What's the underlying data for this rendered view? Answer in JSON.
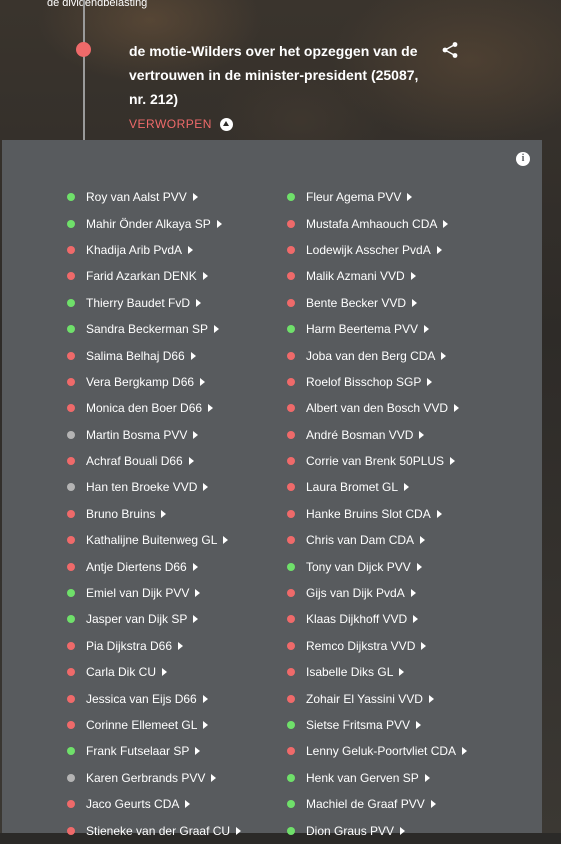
{
  "breadcrumb": "de dividendbelasting",
  "motion": {
    "title": "de motie-Wilders over het opzeggen van de vertrouwen in de minister-president (25087, nr. 212)",
    "result": "VERWORPEN"
  },
  "colors": {
    "voor": "#6fe06a",
    "tegen": "#ef6a6a",
    "afwezig": "#b4b4b4",
    "panel": "#585b5e"
  },
  "icons": {
    "share": "share-icon",
    "info": "info-icon",
    "collapse": "chevron-up-icon"
  },
  "votes_left": [
    {
      "name": "Roy van Aalst PVV",
      "vote": "voor"
    },
    {
      "name": "Mahir Önder Alkaya SP",
      "vote": "voor"
    },
    {
      "name": "Khadija Arib PvdA",
      "vote": "tegen"
    },
    {
      "name": "Farid Azarkan DENK",
      "vote": "tegen"
    },
    {
      "name": "Thierry Baudet FvD",
      "vote": "voor"
    },
    {
      "name": "Sandra Beckerman SP",
      "vote": "voor"
    },
    {
      "name": "Salima Belhaj D66",
      "vote": "tegen"
    },
    {
      "name": "Vera Bergkamp D66",
      "vote": "tegen"
    },
    {
      "name": "Monica den Boer D66",
      "vote": "tegen"
    },
    {
      "name": "Martin Bosma PVV",
      "vote": "afwezig"
    },
    {
      "name": "Achraf Bouali D66",
      "vote": "tegen"
    },
    {
      "name": "Han ten Broeke VVD",
      "vote": "afwezig"
    },
    {
      "name": "Bruno Bruins",
      "vote": "tegen"
    },
    {
      "name": "Kathalijne Buitenweg GL",
      "vote": "tegen"
    },
    {
      "name": "Antje Diertens D66",
      "vote": "tegen"
    },
    {
      "name": "Emiel van Dijk PVV",
      "vote": "voor"
    },
    {
      "name": "Jasper van Dijk SP",
      "vote": "voor"
    },
    {
      "name": "Pia Dijkstra D66",
      "vote": "tegen"
    },
    {
      "name": "Carla Dik CU",
      "vote": "tegen"
    },
    {
      "name": "Jessica van Eijs D66",
      "vote": "tegen"
    },
    {
      "name": "Corinne Ellemeet GL",
      "vote": "tegen"
    },
    {
      "name": "Frank Futselaar SP",
      "vote": "voor"
    },
    {
      "name": "Karen Gerbrands PVV",
      "vote": "afwezig"
    },
    {
      "name": "Jaco Geurts CDA",
      "vote": "tegen"
    },
    {
      "name": "Stieneke van der Graaf CU",
      "vote": "tegen"
    }
  ],
  "votes_right": [
    {
      "name": "Fleur Agema PVV",
      "vote": "voor"
    },
    {
      "name": "Mustafa Amhaouch CDA",
      "vote": "tegen"
    },
    {
      "name": "Lodewijk Asscher PvdA",
      "vote": "tegen"
    },
    {
      "name": "Malik Azmani VVD",
      "vote": "tegen"
    },
    {
      "name": "Bente Becker VVD",
      "vote": "tegen"
    },
    {
      "name": "Harm Beertema PVV",
      "vote": "voor"
    },
    {
      "name": "Joba van den Berg CDA",
      "vote": "tegen"
    },
    {
      "name": "Roelof Bisschop SGP",
      "vote": "tegen"
    },
    {
      "name": "Albert van den Bosch VVD",
      "vote": "tegen"
    },
    {
      "name": "André Bosman VVD",
      "vote": "tegen"
    },
    {
      "name": "Corrie van Brenk 50PLUS",
      "vote": "tegen"
    },
    {
      "name": "Laura Bromet GL",
      "vote": "tegen"
    },
    {
      "name": "Hanke Bruins Slot CDA",
      "vote": "tegen"
    },
    {
      "name": "Chris van Dam CDA",
      "vote": "tegen"
    },
    {
      "name": "Tony van Dijck PVV",
      "vote": "voor"
    },
    {
      "name": "Gijs van Dijk PvdA",
      "vote": "tegen"
    },
    {
      "name": "Klaas Dijkhoff VVD",
      "vote": "tegen"
    },
    {
      "name": "Remco Dijkstra VVD",
      "vote": "tegen"
    },
    {
      "name": "Isabelle Diks GL",
      "vote": "tegen"
    },
    {
      "name": "Zohair El Yassini VVD",
      "vote": "tegen"
    },
    {
      "name": "Sietse Fritsma PVV",
      "vote": "voor"
    },
    {
      "name": "Lenny Geluk-Poortvliet CDA",
      "vote": "tegen"
    },
    {
      "name": "Henk van Gerven SP",
      "vote": "voor"
    },
    {
      "name": "Machiel de Graaf PVV",
      "vote": "voor"
    },
    {
      "name": "Dion Graus PVV",
      "vote": "voor"
    }
  ]
}
